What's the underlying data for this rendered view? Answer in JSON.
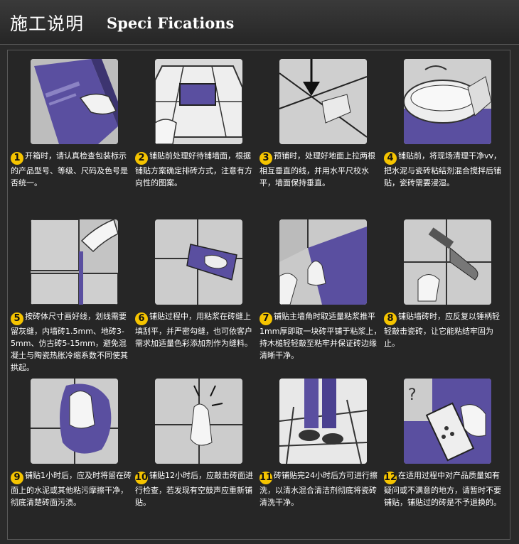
{
  "header": {
    "title_cn": "施工说明",
    "title_en": "Speci Fications"
  },
  "colors": {
    "tile_purple": "#5a4fa0",
    "number_badge": "#f5c400",
    "background": "#2a2a2a"
  },
  "steps": [
    {
      "num": "1",
      "icon": "open-box-icon",
      "text": "开箱时，请认真检查包装标示的产品型号、等级、尺码及色号是否统一。"
    },
    {
      "num": "2",
      "icon": "wall-pattern-icon",
      "text": "铺贴前处理好待铺墙面，根据铺贴方案确定排砖方式，注意有方向性的图案。"
    },
    {
      "num": "3",
      "icon": "level-line-icon",
      "text": "预铺时，处理好地面上拉两根相互垂直的线，并用水平尺校水平，墙面保持垂直。"
    },
    {
      "num": "4",
      "icon": "mix-cement-icon",
      "text": "铺贴前，将现场清理干净vv，把水泥与瓷砖粘结剂混合搅拌后铺贴，瓷砖需要浸湿。"
    },
    {
      "num": "5",
      "icon": "grout-gap-icon",
      "text": "按砖体尺寸画好线，划线需要留灰缝，内墙砖1.5mm、地砖3-5mm、仿古砖5-15mm，避免混凝土与陶瓷热胀冷缩系数不同使其拱起。"
    },
    {
      "num": "6",
      "icon": "trowel-icon",
      "text": "铺贴过程中，用粘浆在砖缝上填刮平，并严密勾缝，也可依客户需求加适量色彩添加剂作为缝料。"
    },
    {
      "num": "7",
      "icon": "corner-tile-icon",
      "text": "铺贴主墙角时取适量粘浆推平1mm厚即取一块砖平铺于粘浆上，持木槌轻轻敲至粘牢并保证砖边缘清晰干净。"
    },
    {
      "num": "8",
      "icon": "hammer-icon",
      "text": "铺贴墙砖时，应反复以锤柄轻轻敲击瓷砖，让它能粘结牢固为止。"
    },
    {
      "num": "9",
      "icon": "wipe-cloth-icon",
      "text": "铺贴1小时后，应及时将留在砖面上的水泥或其他粘污摩擦干净，彻底清楚砖面污渍。"
    },
    {
      "num": "10",
      "icon": "knock-check-icon",
      "text": "铺贴12小时后，应敲击砖面进行检查，若发现有空鼓声应重新铺贴。"
    },
    {
      "num": "11",
      "icon": "wash-floor-icon",
      "text": "砖铺贴完24小时后方可进行擦洗，以清水混合清洁剂彻底将瓷砖清洗干净。"
    },
    {
      "num": "12",
      "icon": "question-phone-icon",
      "text": "在适用过程中对产品质量如有疑问或不满意的地方，请暂时不要铺贴，铺贴过的砖是不予退换的。"
    }
  ]
}
